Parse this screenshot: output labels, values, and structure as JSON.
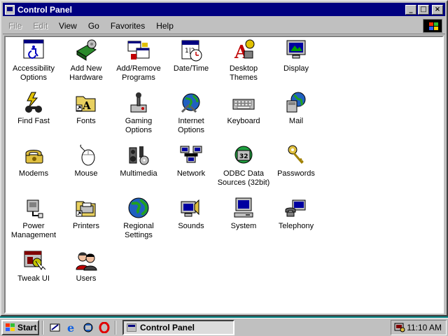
{
  "window": {
    "title": "Control Panel",
    "buttons": {
      "minimize": "_",
      "maximize": "□",
      "close": "×"
    }
  },
  "menu": [
    {
      "label": "File",
      "disabled": true
    },
    {
      "label": "Edit",
      "disabled": true
    },
    {
      "label": "View",
      "disabled": false
    },
    {
      "label": "Go",
      "disabled": false
    },
    {
      "label": "Favorites",
      "disabled": false
    },
    {
      "label": "Help",
      "disabled": false
    }
  ],
  "items": [
    {
      "label": "Accessibility Options",
      "icon": "accessibility-icon"
    },
    {
      "label": "Add New Hardware",
      "icon": "add-hardware-icon"
    },
    {
      "label": "Add/Remove Programs",
      "icon": "add-remove-programs-icon"
    },
    {
      "label": "Date/Time",
      "icon": "calendar-clock-icon"
    },
    {
      "label": "Desktop Themes",
      "icon": "desktop-themes-icon"
    },
    {
      "label": "Display",
      "icon": "display-icon"
    },
    {
      "label": "Find Fast",
      "icon": "find-fast-icon"
    },
    {
      "label": "Fonts",
      "icon": "fonts-folder-icon"
    },
    {
      "label": "Gaming Options",
      "icon": "joystick-icon"
    },
    {
      "label": "Internet Options",
      "icon": "globe-tools-icon"
    },
    {
      "label": "Keyboard",
      "icon": "keyboard-icon"
    },
    {
      "label": "Mail",
      "icon": "mail-icon"
    },
    {
      "label": "Modems",
      "icon": "modem-phone-icon"
    },
    {
      "label": "Mouse",
      "icon": "mouse-icon"
    },
    {
      "label": "Multimedia",
      "icon": "multimedia-icon"
    },
    {
      "label": "Network",
      "icon": "network-icon"
    },
    {
      "label": "ODBC Data Sources (32bit)",
      "icon": "odbc-icon"
    },
    {
      "label": "Passwords",
      "icon": "keys-icon"
    },
    {
      "label": "Power Management",
      "icon": "power-plug-icon"
    },
    {
      "label": "Printers",
      "icon": "printer-folder-icon"
    },
    {
      "label": "Regional Settings",
      "icon": "globe-icon"
    },
    {
      "label": "Sounds",
      "icon": "speaker-icon"
    },
    {
      "label": "System",
      "icon": "computer-icon"
    },
    {
      "label": "Telephony",
      "icon": "telephone-computer-icon"
    },
    {
      "label": "Tweak UI",
      "icon": "tweak-ui-icon"
    },
    {
      "label": "Users",
      "icon": "users-icon"
    }
  ],
  "taskbar": {
    "start_label": "Start",
    "task_label": "Control Panel",
    "clock": "11:10 AM",
    "quicklaunch": [
      "show-desktop-icon",
      "internet-explorer-icon",
      "channels-icon",
      "opera-icon"
    ]
  },
  "colors": {
    "title_bar": "#000080",
    "face": "#c0c0c0",
    "client": "#ffffff"
  }
}
